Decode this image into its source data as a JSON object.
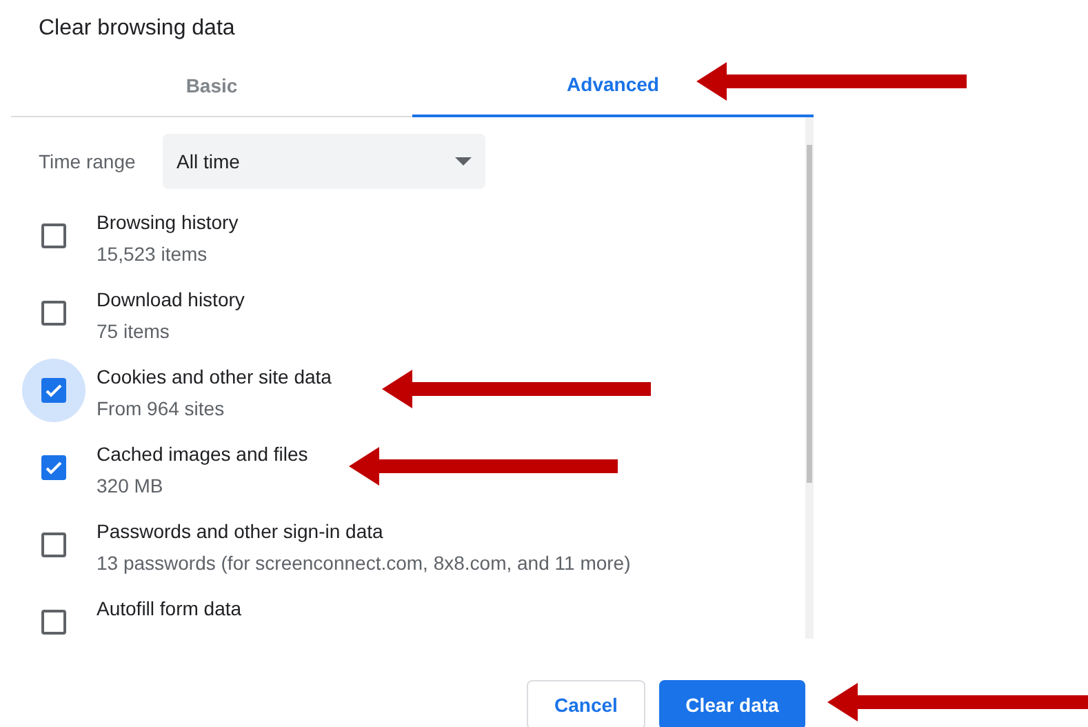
{
  "dialog": {
    "title": "Clear browsing data"
  },
  "tabs": [
    {
      "label": "Basic",
      "selected": false
    },
    {
      "label": "Advanced",
      "selected": true
    }
  ],
  "time_range": {
    "label": "Time range",
    "value": "All time"
  },
  "items": [
    {
      "label": "Browsing history",
      "detail": "15,523 items",
      "checked": false,
      "focused": false
    },
    {
      "label": "Download history",
      "detail": "75 items",
      "checked": false,
      "focused": false
    },
    {
      "label": "Cookies and other site data",
      "detail": "From 964 sites",
      "checked": true,
      "focused": true
    },
    {
      "label": "Cached images and files",
      "detail": "320 MB",
      "checked": true,
      "focused": false
    },
    {
      "label": "Passwords and other sign-in data",
      "detail": "13 passwords (for screenconnect.com, 8x8.com, and 11 more)",
      "checked": false,
      "focused": false
    },
    {
      "label": "Autofill form data",
      "checked": false,
      "focused": false
    }
  ],
  "buttons": [
    {
      "label": "Cancel",
      "kind": "secondary"
    },
    {
      "label": "Clear data",
      "kind": "primary"
    }
  ]
}
